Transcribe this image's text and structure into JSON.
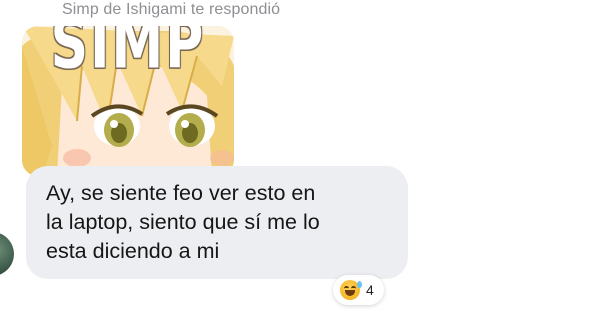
{
  "reply_header": "Simp de Ishigami te respondió",
  "sticker": {
    "caption": "SIMP",
    "icon": "anime-girl-sticker"
  },
  "message": {
    "lines": [
      "Ay, se siente feo ver esto en",
      "la laptop, siento que sí me lo",
      "esta diciendo a mi"
    ]
  },
  "reaction": {
    "emoji": "grinning-squinting-sweat-face",
    "count": "4"
  },
  "colors": {
    "bubble": "#eceef1",
    "header_text": "#8e8e93",
    "hair": "#f3d27a",
    "eyes": "#a9a44a"
  }
}
